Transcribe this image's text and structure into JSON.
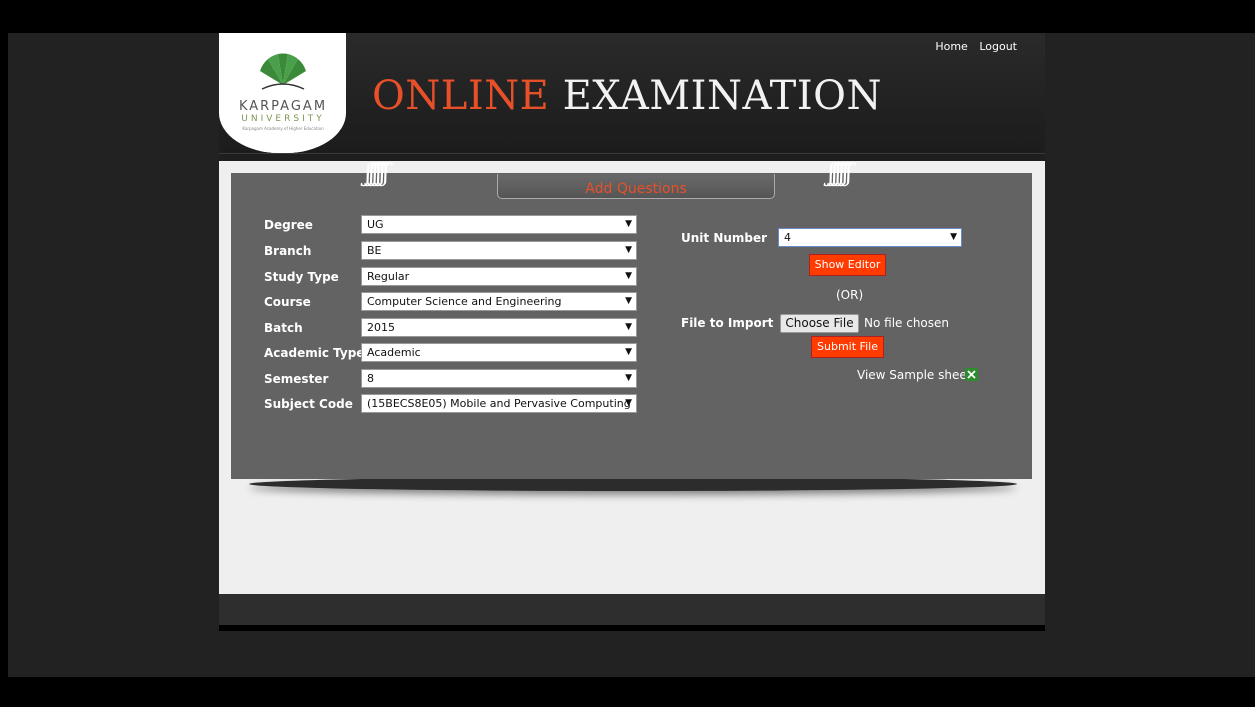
{
  "nav": {
    "home": "Home",
    "logout": "Logout"
  },
  "logo": {
    "line1": "KARPAGAM",
    "line2": "UNIVERSITY",
    "tagline": "Karpagam Academy of Higher Education"
  },
  "title": {
    "part1": "ONLINE",
    "part2": " EXAMINATION"
  },
  "tab": {
    "label": "Add Questions"
  },
  "form_left": [
    {
      "label": "Degree",
      "value": "UG"
    },
    {
      "label": "Branch",
      "value": "BE"
    },
    {
      "label": "Study Type",
      "value": "Regular"
    },
    {
      "label": "Course",
      "value": "Computer Science and Engineering"
    },
    {
      "label": "Batch",
      "value": "2015"
    },
    {
      "label": "Academic Type",
      "value": "Academic"
    },
    {
      "label": "Semester",
      "value": "8"
    },
    {
      "label": "Subject Code",
      "value": "(15BECS8E05) Mobile and Pervasive Computing"
    }
  ],
  "unit": {
    "label": "Unit Number",
    "value": "4"
  },
  "buttons": {
    "show_editor": "Show Editor",
    "or": "(OR)",
    "file_label": "File to Import",
    "choose_file": "Choose File",
    "no_file": "No file chosen",
    "submit_file": "Submit File",
    "sample_sheet": "View Sample sheet"
  },
  "dropdown_arrow": "▼",
  "colors": {
    "accent": "#e8502a",
    "button_red": "#ff3b00",
    "panel": "#636363"
  }
}
